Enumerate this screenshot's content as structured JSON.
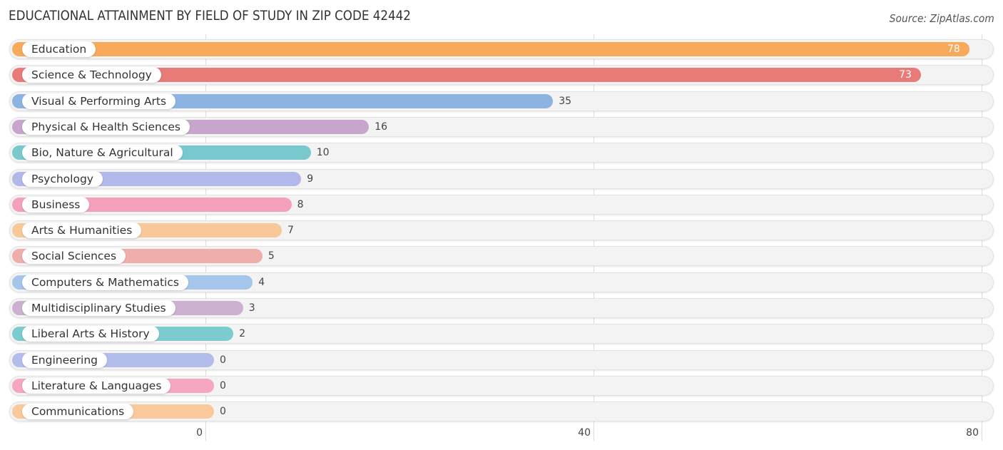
{
  "header": {
    "title": "EDUCATIONAL ATTAINMENT BY FIELD OF STUDY IN ZIP CODE 42442",
    "source": "Source: ZipAtlas.com"
  },
  "chart_data": {
    "type": "bar",
    "orientation": "horizontal",
    "title": "EDUCATIONAL ATTAINMENT BY FIELD OF STUDY IN ZIP CODE 42442",
    "xlabel": "",
    "ylabel": "",
    "xlim": [
      0,
      80
    ],
    "x_ticks": [
      "0",
      "40",
      "80"
    ],
    "x_tick_values": [
      0,
      40,
      80
    ],
    "grid": true,
    "categories": [
      "Education",
      "Science & Technology",
      "Visual & Performing Arts",
      "Physical & Health Sciences",
      "Bio, Nature & Agricultural",
      "Psychology",
      "Business",
      "Arts & Humanities",
      "Social Sciences",
      "Computers & Mathematics",
      "Multidisciplinary Studies",
      "Liberal Arts & History",
      "Engineering",
      "Literature & Languages",
      "Communications"
    ],
    "values": [
      78,
      73,
      35,
      16,
      10,
      9,
      8,
      7,
      5,
      4,
      3,
      2,
      0,
      0,
      0
    ],
    "value_labels": [
      "78",
      "73",
      "35",
      "16",
      "10",
      "9",
      "8",
      "7",
      "5",
      "4",
      "3",
      "2",
      "0",
      "0",
      "0"
    ],
    "colors": [
      "#f8a95a",
      "#e87b78",
      "#8db3e2",
      "#c6a7cb",
      "#78c8cd",
      "#b2b9ea",
      "#f5a0bb",
      "#f9c898",
      "#f0aeaa",
      "#a5c5ea",
      "#cdafd2",
      "#7ccbd0",
      "#b3bdeb",
      "#f6a6c0",
      "#f9c99c"
    ]
  }
}
